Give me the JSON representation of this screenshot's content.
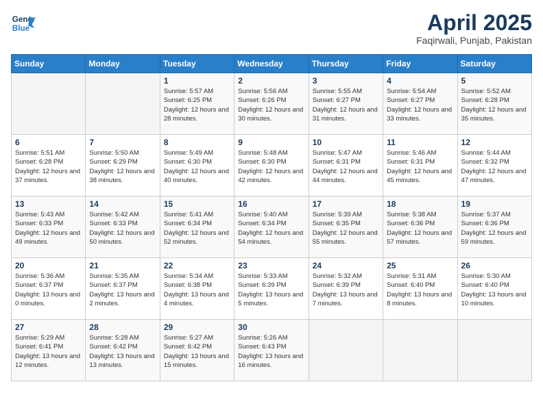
{
  "header": {
    "logo_line1": "General",
    "logo_line2": "Blue",
    "month_title": "April 2025",
    "location": "Faqirwali, Punjab, Pakistan"
  },
  "weekdays": [
    "Sunday",
    "Monday",
    "Tuesday",
    "Wednesday",
    "Thursday",
    "Friday",
    "Saturday"
  ],
  "weeks": [
    [
      {
        "day": "",
        "sunrise": "",
        "sunset": "",
        "daylight": ""
      },
      {
        "day": "",
        "sunrise": "",
        "sunset": "",
        "daylight": ""
      },
      {
        "day": "1",
        "sunrise": "Sunrise: 5:57 AM",
        "sunset": "Sunset: 6:25 PM",
        "daylight": "Daylight: 12 hours and 28 minutes."
      },
      {
        "day": "2",
        "sunrise": "Sunrise: 5:56 AM",
        "sunset": "Sunset: 6:26 PM",
        "daylight": "Daylight: 12 hours and 30 minutes."
      },
      {
        "day": "3",
        "sunrise": "Sunrise: 5:55 AM",
        "sunset": "Sunset: 6:27 PM",
        "daylight": "Daylight: 12 hours and 31 minutes."
      },
      {
        "day": "4",
        "sunrise": "Sunrise: 5:54 AM",
        "sunset": "Sunset: 6:27 PM",
        "daylight": "Daylight: 12 hours and 33 minutes."
      },
      {
        "day": "5",
        "sunrise": "Sunrise: 5:52 AM",
        "sunset": "Sunset: 6:28 PM",
        "daylight": "Daylight: 12 hours and 35 minutes."
      }
    ],
    [
      {
        "day": "6",
        "sunrise": "Sunrise: 5:51 AM",
        "sunset": "Sunset: 6:28 PM",
        "daylight": "Daylight: 12 hours and 37 minutes."
      },
      {
        "day": "7",
        "sunrise": "Sunrise: 5:50 AM",
        "sunset": "Sunset: 6:29 PM",
        "daylight": "Daylight: 12 hours and 38 minutes."
      },
      {
        "day": "8",
        "sunrise": "Sunrise: 5:49 AM",
        "sunset": "Sunset: 6:30 PM",
        "daylight": "Daylight: 12 hours and 40 minutes."
      },
      {
        "day": "9",
        "sunrise": "Sunrise: 5:48 AM",
        "sunset": "Sunset: 6:30 PM",
        "daylight": "Daylight: 12 hours and 42 minutes."
      },
      {
        "day": "10",
        "sunrise": "Sunrise: 5:47 AM",
        "sunset": "Sunset: 6:31 PM",
        "daylight": "Daylight: 12 hours and 44 minutes."
      },
      {
        "day": "11",
        "sunrise": "Sunrise: 5:46 AM",
        "sunset": "Sunset: 6:31 PM",
        "daylight": "Daylight: 12 hours and 45 minutes."
      },
      {
        "day": "12",
        "sunrise": "Sunrise: 5:44 AM",
        "sunset": "Sunset: 6:32 PM",
        "daylight": "Daylight: 12 hours and 47 minutes."
      }
    ],
    [
      {
        "day": "13",
        "sunrise": "Sunrise: 5:43 AM",
        "sunset": "Sunset: 6:33 PM",
        "daylight": "Daylight: 12 hours and 49 minutes."
      },
      {
        "day": "14",
        "sunrise": "Sunrise: 5:42 AM",
        "sunset": "Sunset: 6:33 PM",
        "daylight": "Daylight: 12 hours and 50 minutes."
      },
      {
        "day": "15",
        "sunrise": "Sunrise: 5:41 AM",
        "sunset": "Sunset: 6:34 PM",
        "daylight": "Daylight: 12 hours and 52 minutes."
      },
      {
        "day": "16",
        "sunrise": "Sunrise: 5:40 AM",
        "sunset": "Sunset: 6:34 PM",
        "daylight": "Daylight: 12 hours and 54 minutes."
      },
      {
        "day": "17",
        "sunrise": "Sunrise: 5:39 AM",
        "sunset": "Sunset: 6:35 PM",
        "daylight": "Daylight: 12 hours and 55 minutes."
      },
      {
        "day": "18",
        "sunrise": "Sunrise: 5:38 AM",
        "sunset": "Sunset: 6:36 PM",
        "daylight": "Daylight: 12 hours and 57 minutes."
      },
      {
        "day": "19",
        "sunrise": "Sunrise: 5:37 AM",
        "sunset": "Sunset: 6:36 PM",
        "daylight": "Daylight: 12 hours and 59 minutes."
      }
    ],
    [
      {
        "day": "20",
        "sunrise": "Sunrise: 5:36 AM",
        "sunset": "Sunset: 6:37 PM",
        "daylight": "Daylight: 13 hours and 0 minutes."
      },
      {
        "day": "21",
        "sunrise": "Sunrise: 5:35 AM",
        "sunset": "Sunset: 6:37 PM",
        "daylight": "Daylight: 13 hours and 2 minutes."
      },
      {
        "day": "22",
        "sunrise": "Sunrise: 5:34 AM",
        "sunset": "Sunset: 6:38 PM",
        "daylight": "Daylight: 13 hours and 4 minutes."
      },
      {
        "day": "23",
        "sunrise": "Sunrise: 5:33 AM",
        "sunset": "Sunset: 6:39 PM",
        "daylight": "Daylight: 13 hours and 5 minutes."
      },
      {
        "day": "24",
        "sunrise": "Sunrise: 5:32 AM",
        "sunset": "Sunset: 6:39 PM",
        "daylight": "Daylight: 13 hours and 7 minutes."
      },
      {
        "day": "25",
        "sunrise": "Sunrise: 5:31 AM",
        "sunset": "Sunset: 6:40 PM",
        "daylight": "Daylight: 13 hours and 8 minutes."
      },
      {
        "day": "26",
        "sunrise": "Sunrise: 5:30 AM",
        "sunset": "Sunset: 6:40 PM",
        "daylight": "Daylight: 13 hours and 10 minutes."
      }
    ],
    [
      {
        "day": "27",
        "sunrise": "Sunrise: 5:29 AM",
        "sunset": "Sunset: 6:41 PM",
        "daylight": "Daylight: 13 hours and 12 minutes."
      },
      {
        "day": "28",
        "sunrise": "Sunrise: 5:28 AM",
        "sunset": "Sunset: 6:42 PM",
        "daylight": "Daylight: 13 hours and 13 minutes."
      },
      {
        "day": "29",
        "sunrise": "Sunrise: 5:27 AM",
        "sunset": "Sunset: 6:42 PM",
        "daylight": "Daylight: 13 hours and 15 minutes."
      },
      {
        "day": "30",
        "sunrise": "Sunrise: 5:26 AM",
        "sunset": "Sunset: 6:43 PM",
        "daylight": "Daylight: 13 hours and 16 minutes."
      },
      {
        "day": "",
        "sunrise": "",
        "sunset": "",
        "daylight": ""
      },
      {
        "day": "",
        "sunrise": "",
        "sunset": "",
        "daylight": ""
      },
      {
        "day": "",
        "sunrise": "",
        "sunset": "",
        "daylight": ""
      }
    ]
  ]
}
